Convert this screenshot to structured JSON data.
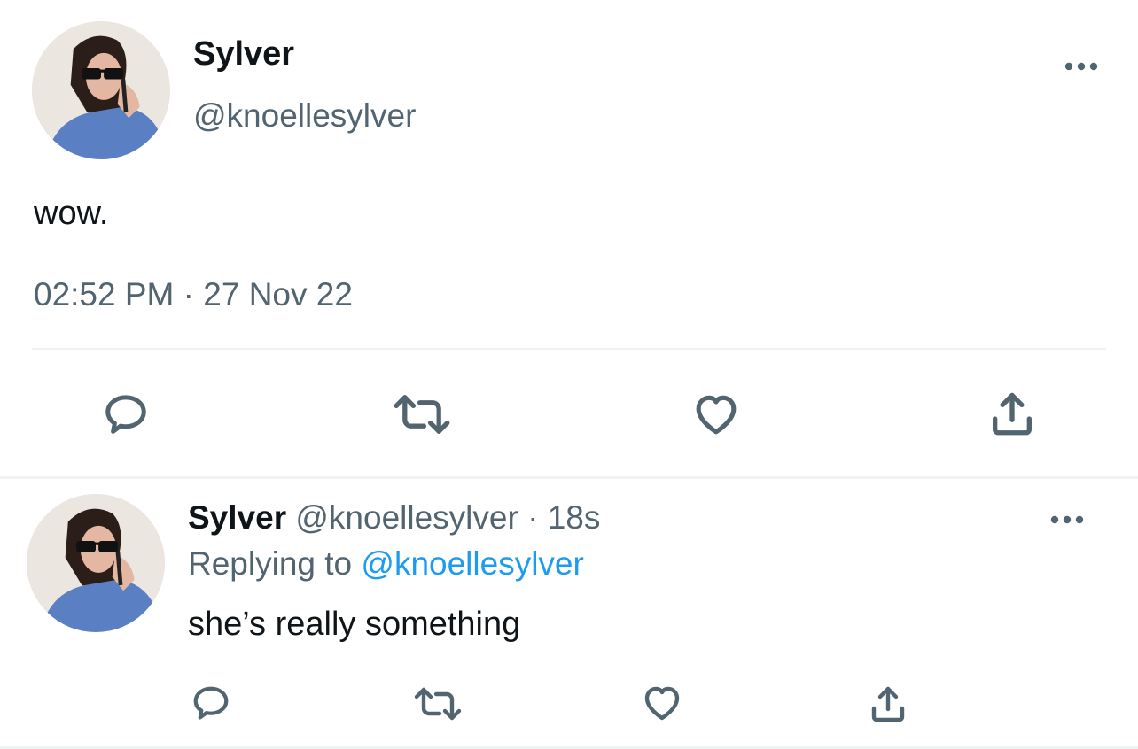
{
  "main_tweet": {
    "display_name": "Sylver",
    "handle": "@knoellesylver",
    "text": "wow.",
    "time": "02:52 PM",
    "separator": "·",
    "date": "27 Nov 22",
    "avatar_icon": "profile-photo",
    "actions": [
      "reply-icon",
      "retweet-icon",
      "like-icon",
      "share-icon"
    ]
  },
  "reply_tweet": {
    "display_name": "Sylver",
    "handle": "@knoellesylver",
    "separator": "·",
    "age": "18s",
    "replying_prefix": "Replying to",
    "replying_handle": "@knoellesylver",
    "text": "she’s really something",
    "avatar_icon": "profile-photo",
    "actions": [
      "reply-icon",
      "retweet-icon",
      "like-icon",
      "share-icon"
    ]
  },
  "colors": {
    "text": "#0f1419",
    "secondary": "#536471",
    "link": "#1d9bf0",
    "divider": "#eff3f4"
  }
}
